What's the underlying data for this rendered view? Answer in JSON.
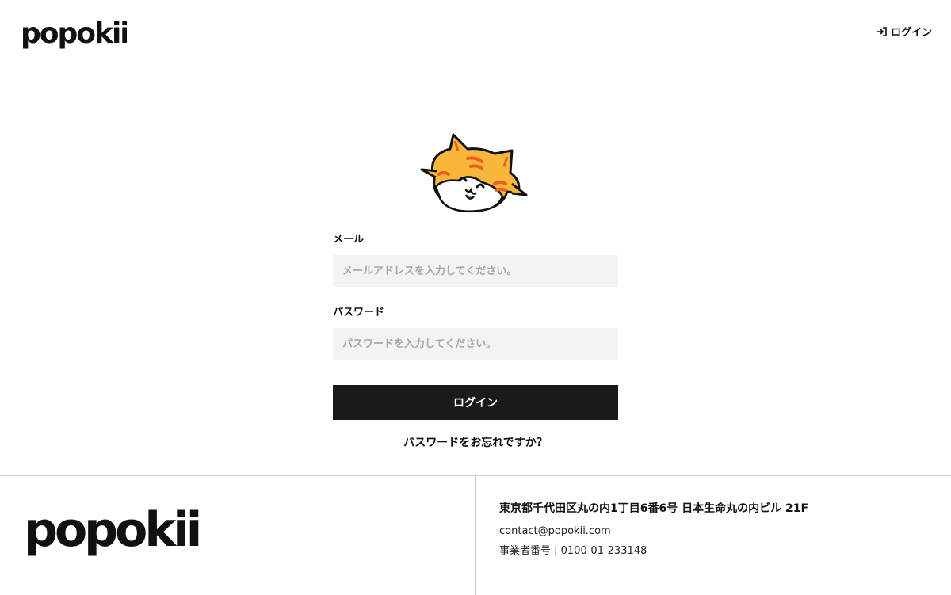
{
  "brand": {
    "name": "popokii"
  },
  "header": {
    "login_label": "ログイン",
    "login_icon": "login-arrow-icon"
  },
  "mascot": {
    "icon": "cat-face-icon"
  },
  "form": {
    "email_label": "メール",
    "email_placeholder": "メールアドレスを入力してください。",
    "email_value": "",
    "password_label": "パスワード",
    "password_placeholder": "パスワードを入力してください。",
    "password_value": "",
    "submit_label": "ログイン",
    "forgot_label": "パスワードをお忘れですか？"
  },
  "footer": {
    "address": "東京都千代田区丸の内1丁目6番6号 日本生命丸の内ビル 21F",
    "email": "contact@popokii.com",
    "business_number": "事業者番号 | 0100-01-233148"
  },
  "colors": {
    "button_bg": "#1a1a1a",
    "input_bg": "#f3f3f3",
    "cat_orange": "#f8b73a",
    "cat_stripe": "#e8601a"
  }
}
